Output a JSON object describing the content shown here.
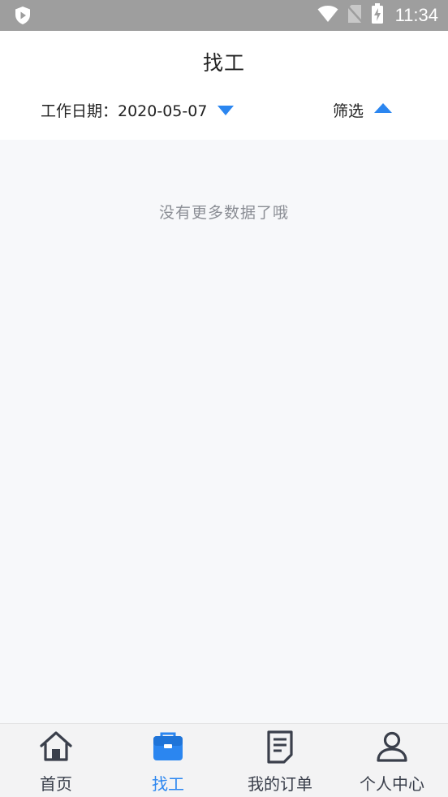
{
  "status_bar": {
    "time": "11:34",
    "icons": [
      "app-shield-icon",
      "wifi-icon",
      "no-sim-icon",
      "battery-charging-icon"
    ]
  },
  "header": {
    "title": "找工",
    "date_filter": {
      "label": "工作日期：2020-05-07",
      "icon": "caret-down-icon"
    },
    "screen_filter": {
      "label": "筛选",
      "icon": "caret-up-icon"
    }
  },
  "content": {
    "empty_message": "没有更多数据了哦"
  },
  "tab_bar": {
    "items": [
      {
        "label": "首页",
        "icon": "home-icon",
        "active": false
      },
      {
        "label": "找工",
        "icon": "briefcase-icon",
        "active": true
      },
      {
        "label": "我的订单",
        "icon": "order-document-icon",
        "active": false
      },
      {
        "label": "个人中心",
        "icon": "person-icon",
        "active": false
      }
    ]
  },
  "colors": {
    "accent": "#2b86f0",
    "status_bar": "#9e9e9e",
    "text_primary": "#222222",
    "text_muted": "#8a8d94",
    "background": "#f7f8fa"
  }
}
